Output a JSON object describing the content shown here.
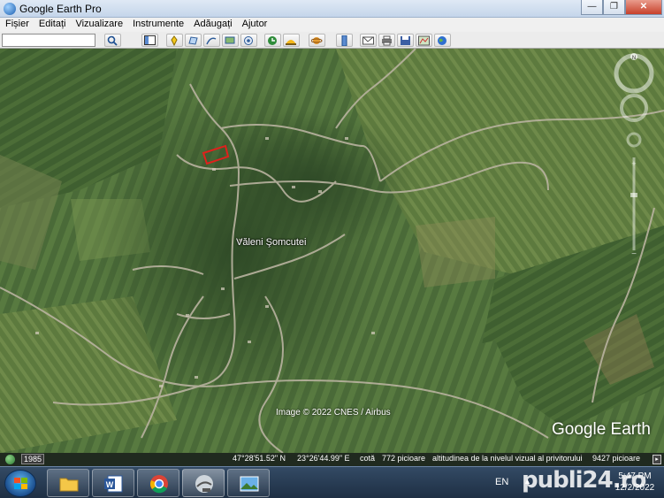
{
  "window": {
    "title": "Google Earth Pro"
  },
  "menu": [
    {
      "label": "Fișier"
    },
    {
      "label": "Editați"
    },
    {
      "label": "Vizualizare"
    },
    {
      "label": "Instrumente"
    },
    {
      "label": "Adăugați"
    },
    {
      "label": "Ajutor"
    }
  ],
  "toolbar": {
    "search_value": "",
    "buttons": [
      "search-icon",
      "sidebar-icon",
      "placemark-icon",
      "polygon-icon",
      "path-icon",
      "overlay-icon",
      "tour-icon",
      "history-icon",
      "sun-icon",
      "planet-icon",
      "ruler-icon",
      "email-icon",
      "print-icon",
      "save-image-icon",
      "maps-icon",
      "earth-icon"
    ]
  },
  "map": {
    "place_label": "Văleni Şomcutei",
    "image_credit": "Image © 2022 CNES / Airbus",
    "logo": "Google Earth",
    "compass_letter": "N"
  },
  "status": {
    "year": "1985",
    "latitude": "47°28'51.52\" N",
    "longitude": "23°26'44.99\" E",
    "elevation_label": "cotă",
    "elevation_value": "772 picioare",
    "eye_alt_label": "altitudinea de la nivelul vizual al privitorului",
    "eye_alt_value": "9427 picioare"
  },
  "taskbar": {
    "items": [
      "folder-icon",
      "word-icon",
      "chrome-icon",
      "google-earth-pro-icon",
      "photos-icon"
    ],
    "active_index": 3,
    "language": "EN",
    "time": "5:47 PM",
    "date": "12/2/2022"
  },
  "watermark": "publi24.ro",
  "colors": {
    "titlebar": "#c4d5ea",
    "taskbar": "#1e2f44",
    "highlight_polygon": "#e0201c"
  }
}
